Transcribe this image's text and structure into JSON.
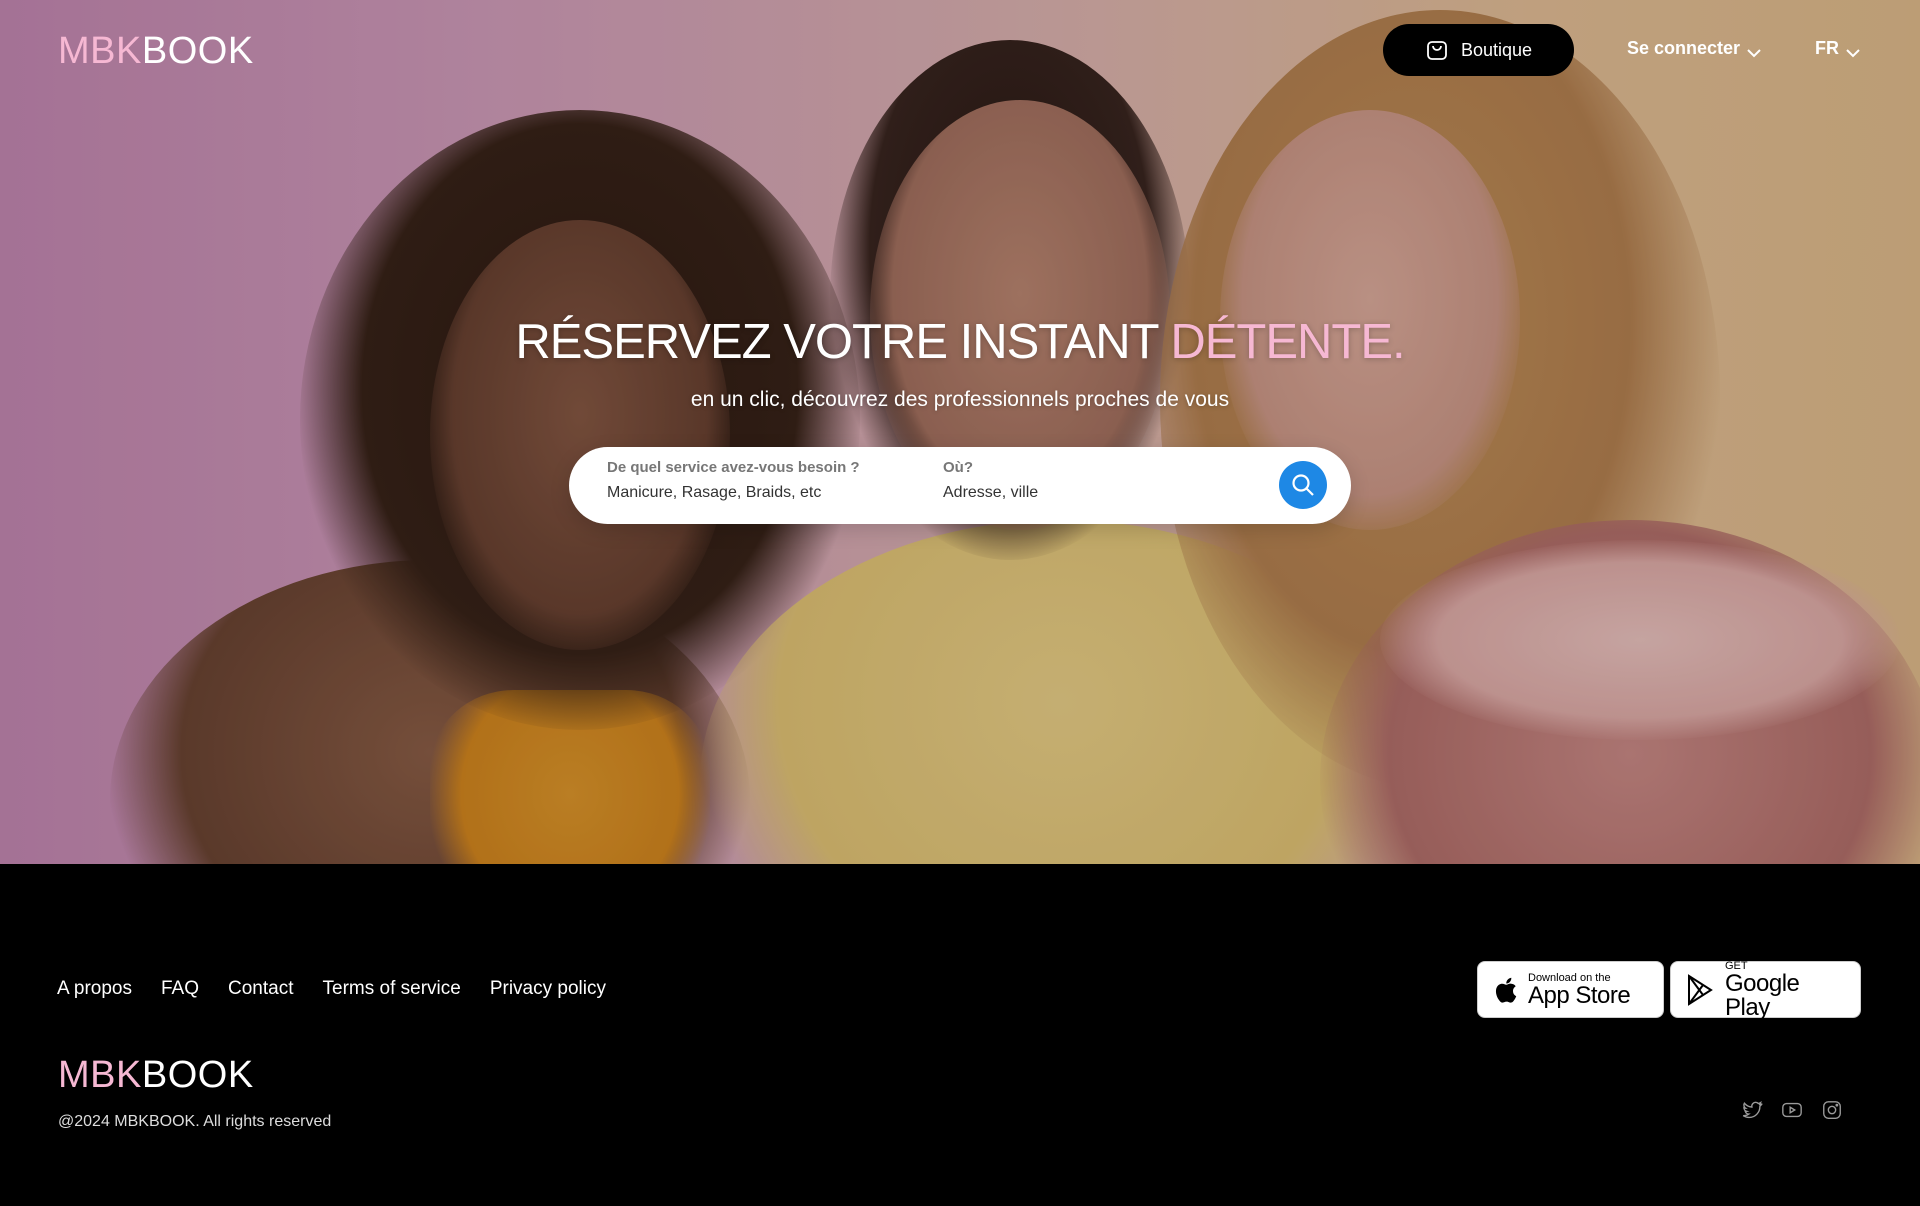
{
  "brand": {
    "logo_part1": "MBK",
    "logo_part2": "BOOK",
    "accent_color": "#f6b8d3"
  },
  "nav": {
    "boutique_label": "Boutique",
    "login_label": "Se connecter",
    "lang_label": "FR"
  },
  "hero": {
    "title_main": "RÉSERVEZ VOTRE INSTANT ",
    "title_accent": "DÉTENTE.",
    "subtitle": "en un clic, découvrez des professionnels proches de vous"
  },
  "search": {
    "service_label": "De quel service avez-vous besoin ?",
    "service_placeholder": "Manicure, Rasage, Braids, etc",
    "where_label": "Où?",
    "where_placeholder": "Adresse, ville",
    "button_color": "#1e88e5"
  },
  "footer": {
    "links": [
      "A propos",
      "FAQ",
      "Contact",
      "Terms of service",
      "Privacy policy"
    ],
    "copyright": "@2024 MBKBOOK. All rights reserved",
    "app_store": {
      "small": "Download on the",
      "big": "App Store"
    },
    "google_play": {
      "small": "GET",
      "big": "Google Play"
    },
    "social_icons": [
      "twitter-icon",
      "youtube-icon",
      "instagram-icon"
    ]
  }
}
